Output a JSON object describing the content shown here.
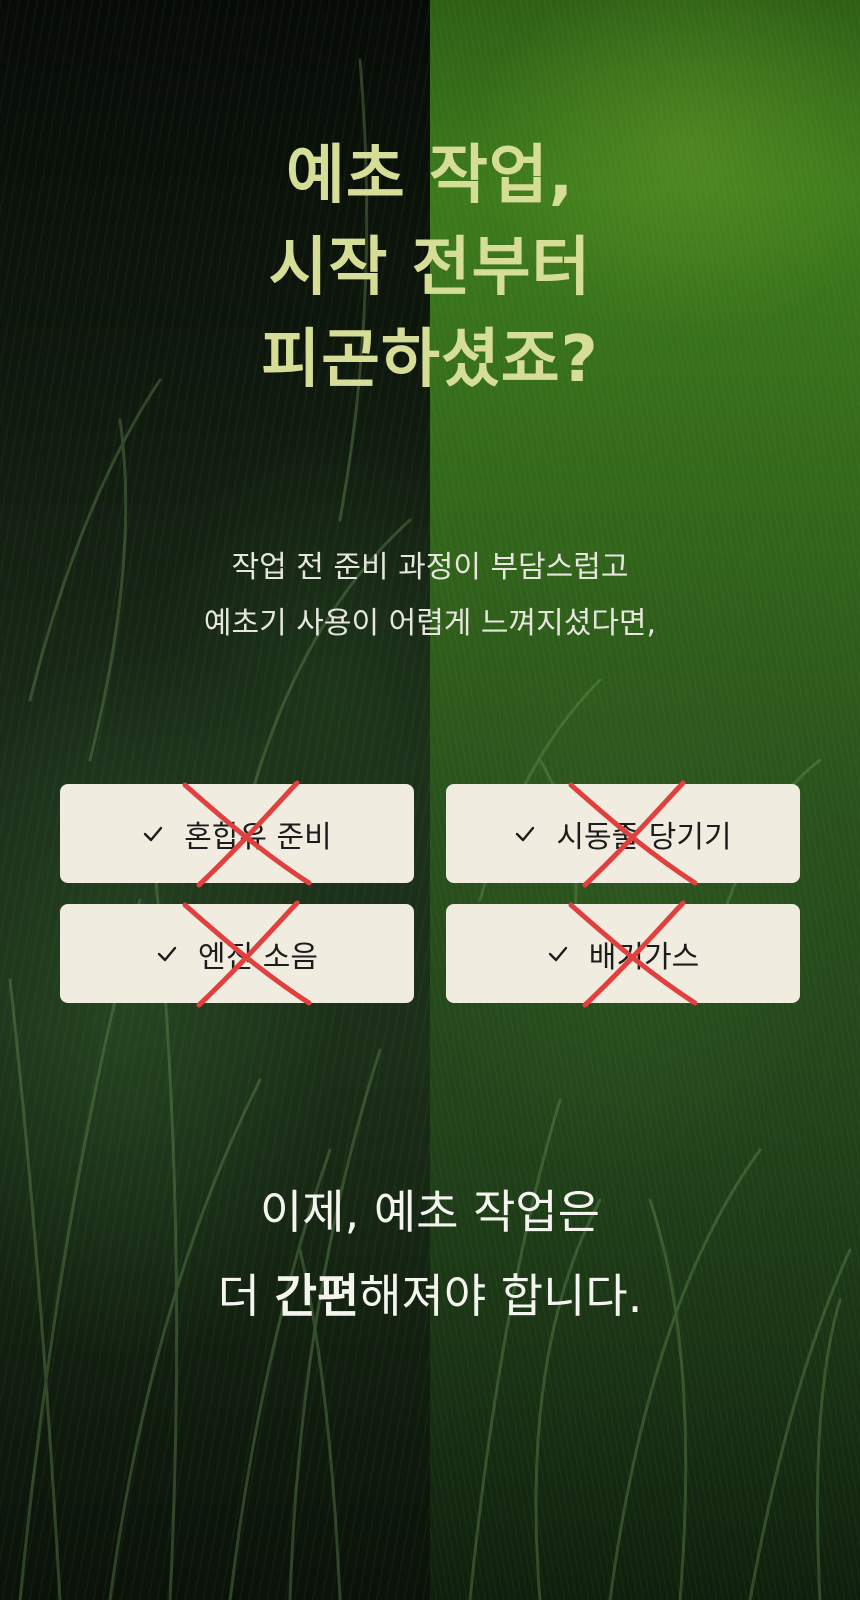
{
  "headline": {
    "lines": [
      "예초 작업,",
      "시작 전부터",
      "피곤하셨죠?"
    ]
  },
  "subtext": {
    "lines": [
      "작업 전 준비 과정이 부담스럽고",
      "예초기 사용이 어렵게 느껴지셨다면,"
    ]
  },
  "tags": [
    {
      "label": "혼합유 준비",
      "icon": "check-icon",
      "crossed": true
    },
    {
      "label": "시동줄 당기기",
      "icon": "check-icon",
      "crossed": true
    },
    {
      "label": "엔진 소음",
      "icon": "check-icon",
      "crossed": true
    },
    {
      "label": "배기가스",
      "icon": "check-icon",
      "crossed": true
    }
  ],
  "closing": {
    "line1": "이제, 예초 작업은",
    "line2_prefix": "더 ",
    "line2_bold": "간편",
    "line2_suffix": "해져야 합니다."
  },
  "colors": {
    "headline": "#d6dd97",
    "tag_background": "#f0ece0",
    "cross_mark": "#e0403f",
    "left_background": "#101a0f",
    "right_background": "#336a1a"
  }
}
